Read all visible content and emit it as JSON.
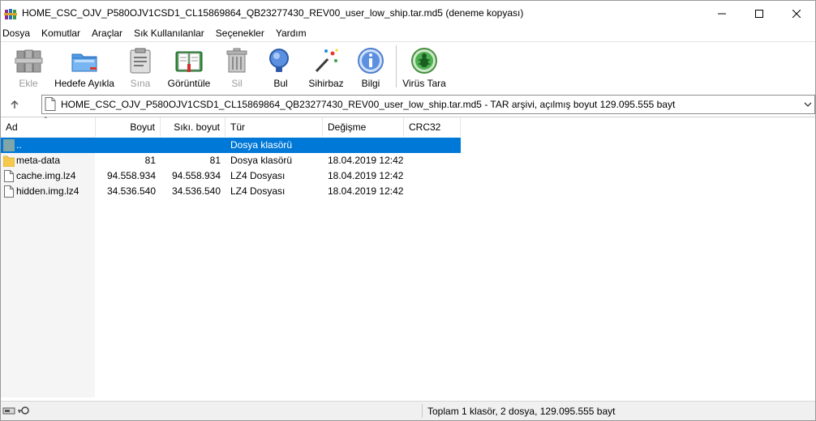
{
  "window": {
    "title": "HOME_CSC_OJV_P580OJV1CSD1_CL15869864_QB23277430_REV00_user_low_ship.tar.md5 (deneme kopyası)",
    "app_icon": "winrar-books-icon"
  },
  "menu": {
    "items": [
      "Dosya",
      "Komutlar",
      "Araçlar",
      "Sık Kullanılanlar",
      "Seçenekler",
      "Yardım"
    ]
  },
  "toolbar": {
    "buttons": [
      {
        "label": "Ekle",
        "icon": "add-archive-icon",
        "enabled": false
      },
      {
        "label": "Hedefe Ayıkla",
        "icon": "extract-folder-icon",
        "enabled": true
      },
      {
        "label": "Sına",
        "icon": "test-clipboard-icon",
        "enabled": false
      },
      {
        "label": "Görüntüle",
        "icon": "view-book-icon",
        "enabled": true
      },
      {
        "label": "Sil",
        "icon": "trash-can-icon",
        "enabled": false
      },
      {
        "label": "Bul",
        "icon": "magnifier-icon",
        "enabled": true
      },
      {
        "label": "Sihirbaz",
        "icon": "magic-wand-icon",
        "enabled": true
      },
      {
        "label": "Bilgi",
        "icon": "info-icon",
        "enabled": true
      },
      {
        "label": "Virüs Tara",
        "icon": "virus-scan-icon",
        "enabled": true
      }
    ]
  },
  "address": {
    "text": "HOME_CSC_OJV_P580OJV1CSD1_CL15869864_QB23277430_REV00_user_low_ship.tar.md5 - TAR arşivi, açılmış boyut 129.095.555 bayt"
  },
  "columns": {
    "name": "Ad",
    "size": "Boyut",
    "packed": "Sıkı. boyut",
    "type": "Tür",
    "modified": "Değişme",
    "crc": "CRC32"
  },
  "files": [
    {
      "name": "..",
      "size": "",
      "packed": "",
      "type": "Dosya klasörü",
      "modified": "",
      "crc": "",
      "icon": "parent-folder-icon",
      "selected": true
    },
    {
      "name": "meta-data",
      "size": "81",
      "packed": "81",
      "type": "Dosya klasörü",
      "modified": "18.04.2019 12:42",
      "crc": "",
      "icon": "folder-icon",
      "selected": false
    },
    {
      "name": "cache.img.lz4",
      "size": "94.558.934",
      "packed": "94.558.934",
      "type": "LZ4 Dosyası",
      "modified": "18.04.2019 12:42",
      "crc": "",
      "icon": "file-icon",
      "selected": false
    },
    {
      "name": "hidden.img.lz4",
      "size": "34.536.540",
      "packed": "34.536.540",
      "type": "LZ4 Dosyası",
      "modified": "18.04.2019 12:42",
      "crc": "",
      "icon": "file-icon",
      "selected": false
    }
  ],
  "status": {
    "summary": "Toplam 1 klasör, 2 dosya, 129.095.555 bayt"
  },
  "colors": {
    "selection": "#0078d7"
  }
}
